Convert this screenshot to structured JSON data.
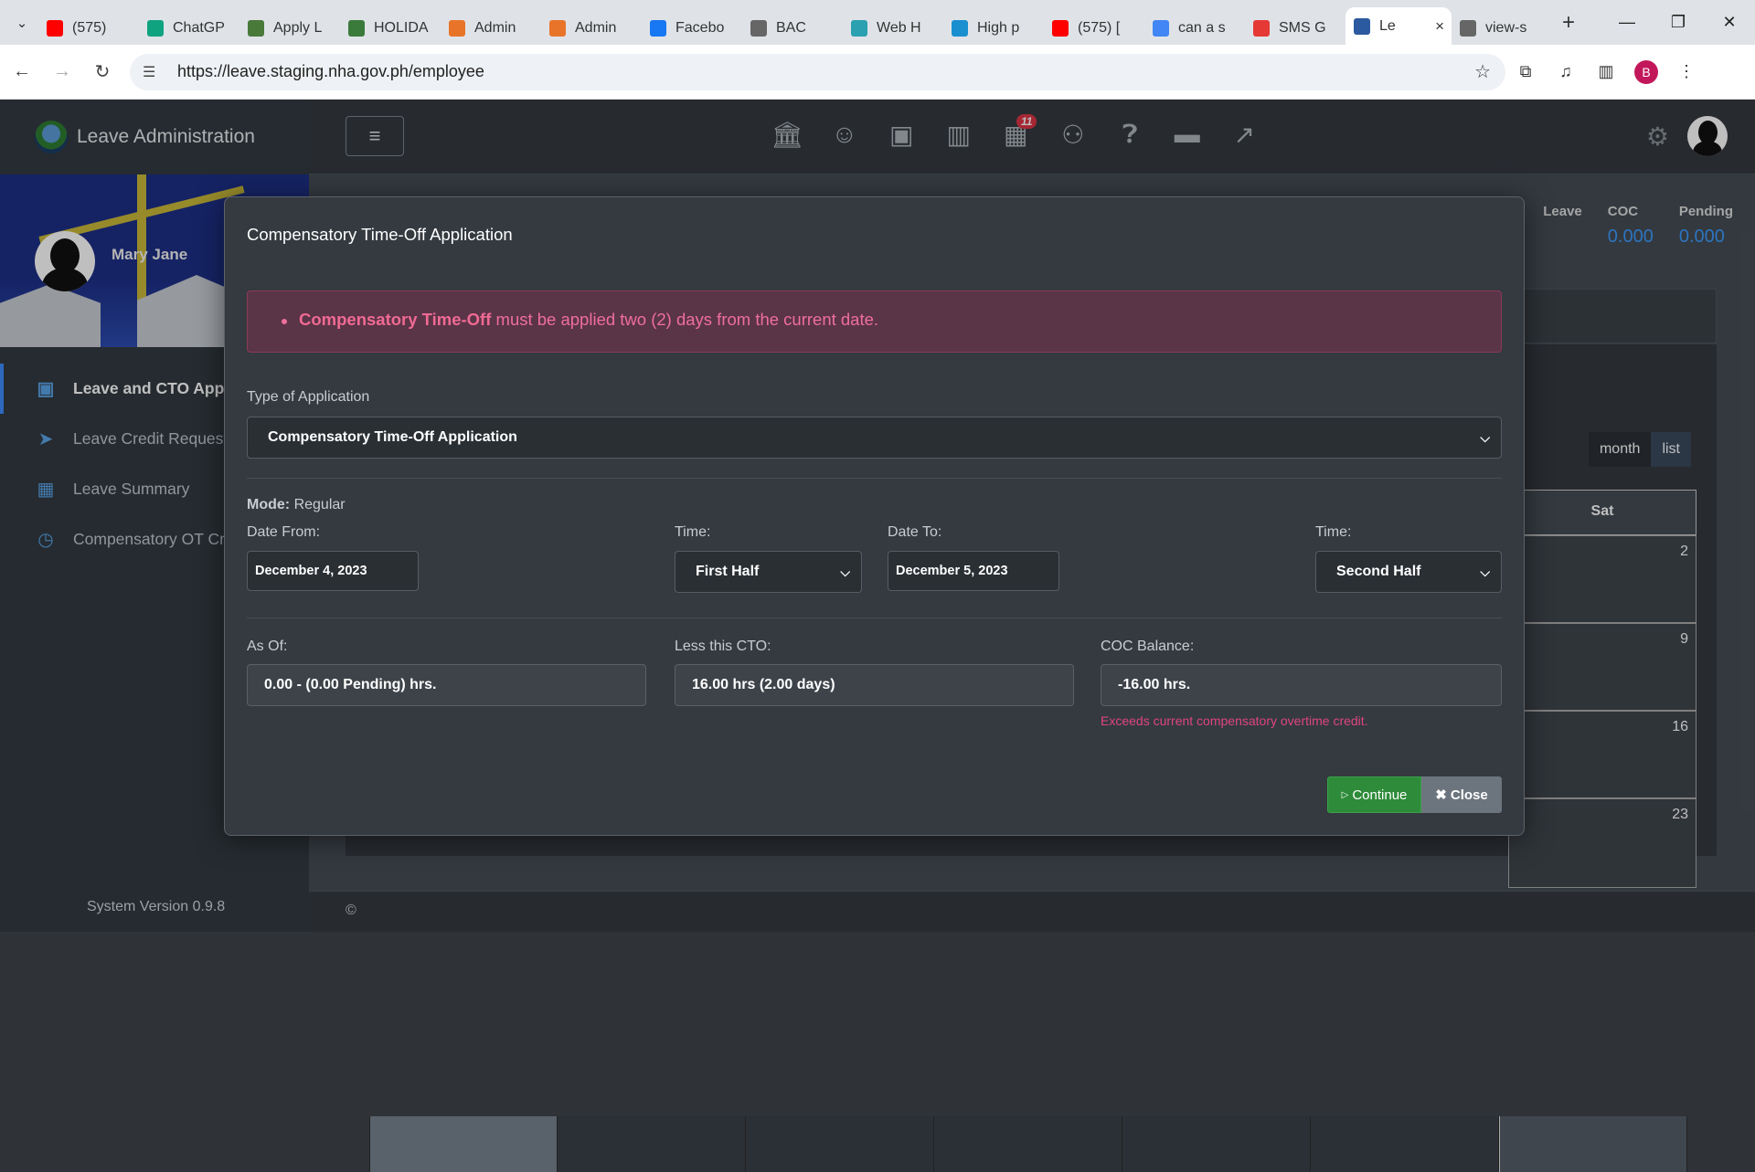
{
  "browser": {
    "tabs": [
      {
        "title": "(575)",
        "icon": "youtube-icon",
        "color": "#ff0000"
      },
      {
        "title": "ChatGP",
        "icon": "chatgpt-icon",
        "color": "#10a37f"
      },
      {
        "title": "Apply L",
        "icon": "site-icon",
        "color": "#4a7a3a"
      },
      {
        "title": "HOLIDA",
        "icon": "site-icon",
        "color": "#3a7a3a"
      },
      {
        "title": "Admin",
        "icon": "admin-icon",
        "color": "#e8742a"
      },
      {
        "title": "Admin",
        "icon": "admin-icon",
        "color": "#e8742a"
      },
      {
        "title": "Facebo",
        "icon": "facebook-icon",
        "color": "#1877f2"
      },
      {
        "title": "BAC",
        "icon": "globe-icon",
        "color": "#666666"
      },
      {
        "title": "Web H",
        "icon": "web-icon",
        "color": "#2aa0b0"
      },
      {
        "title": "High p",
        "icon": "sms-icon",
        "color": "#1a8fd0"
      },
      {
        "title": "(575) [",
        "icon": "youtube-icon",
        "color": "#ff0000"
      },
      {
        "title": "can a s",
        "icon": "google-icon",
        "color": "#4285f4"
      },
      {
        "title": "SMS G",
        "icon": "sms-icon",
        "color": "#e53935"
      },
      {
        "title": "Le",
        "icon": "leave-icon",
        "color": "#2c5aa0",
        "active": true
      },
      {
        "title": "view-s",
        "icon": "globe-icon",
        "color": "#666666"
      }
    ],
    "url": "https://leave.staging.nha.gov.ph/employee",
    "profile_initial": "B"
  },
  "app": {
    "brand": "Leave Administration",
    "user_name": "Mary Jane",
    "nav": [
      {
        "label": "Leave and CTO Appli",
        "icon": "passport-icon",
        "active": true
      },
      {
        "label": "Leave Credit Request",
        "icon": "paper-plane-icon"
      },
      {
        "label": "Leave Summary",
        "icon": "calculator-icon"
      },
      {
        "label": "Compensatory OT Cr",
        "icon": "clock-icon"
      }
    ],
    "system_version": "System Version 0.9.8",
    "footer": "©",
    "notification_count": "11",
    "stats": [
      {
        "label": "Leave",
        "value": ""
      },
      {
        "label": "COC",
        "value": "0.000"
      },
      {
        "label": "Pending",
        "value": "0.000"
      }
    ],
    "calendar": {
      "month_btn": "month",
      "list_btn": "list",
      "day_header": "Sat",
      "days": [
        "2",
        "9",
        "16",
        "23"
      ]
    }
  },
  "modal": {
    "title": "Compensatory Time-Off Application",
    "alert_bold": "Compensatory Time-Off",
    "alert_text": " must be applied two (2) days from the current date.",
    "type_label": "Type of Application",
    "type_value": "Compensatory Time-Off Application",
    "mode_label": "Mode:",
    "mode_value": "Regular",
    "date_from_label": "Date From:",
    "date_from_value": "December 4, 2023",
    "time1_label": "Time:",
    "time1_value": "First Half",
    "date_to_label": "Date To:",
    "date_to_value": "December 5, 2023",
    "time2_label": "Time:",
    "time2_value": "Second Half",
    "as_of_label": "As Of:",
    "as_of_value": "0.00 - (0.00 Pending) hrs.",
    "less_cto_label": "Less this CTO:",
    "less_cto_value": "16.00 hrs (2.00 days)",
    "coc_balance_label": "COC Balance:",
    "coc_balance_value": "-16.00 hrs.",
    "error_text": "Exceeds current compensatory overtime credit.",
    "continue_label": "Continue",
    "close_label": "Close"
  }
}
